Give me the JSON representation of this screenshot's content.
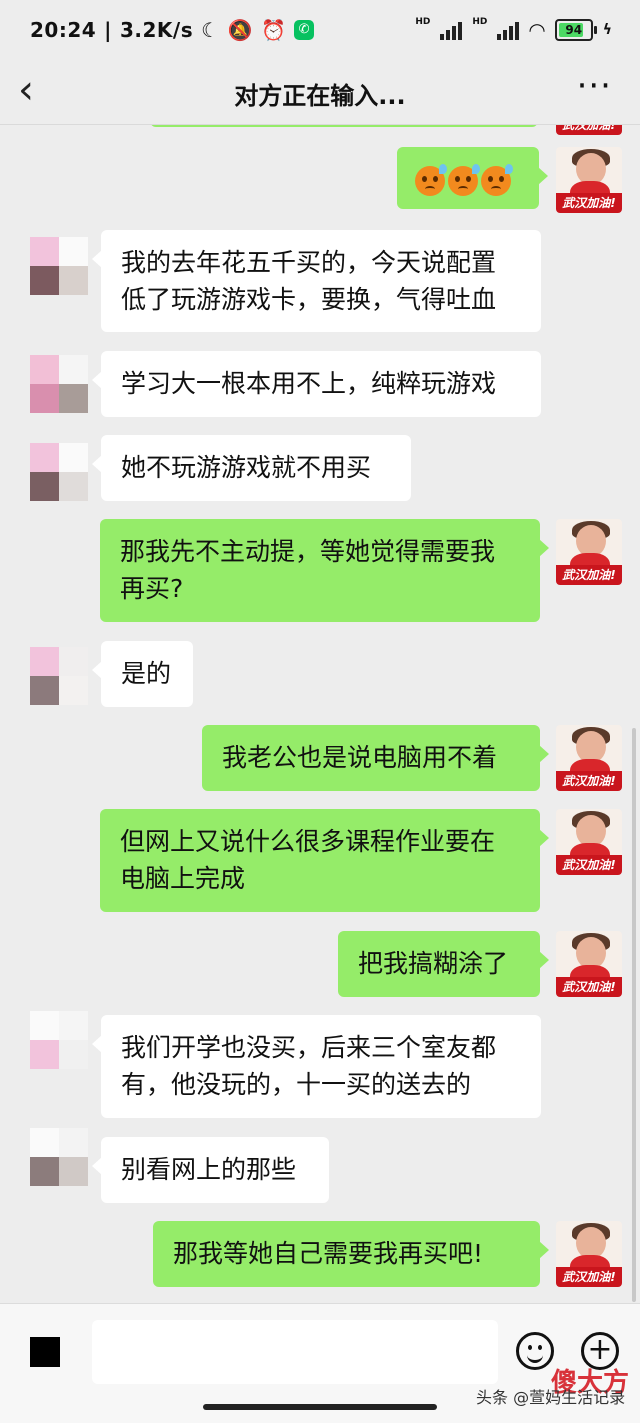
{
  "status_bar": {
    "time": "20:24",
    "speed": "3.2K/s",
    "battery": "94",
    "hd": "HD",
    "chat_app_glyph": "✆",
    "icons": [
      "moon-icon",
      "mute-icon",
      "alarm-icon",
      "wechat-icon",
      "signal-icon",
      "wifi-icon",
      "battery-icon",
      "charging-icon"
    ]
  },
  "header": {
    "title": "对方正在输入...",
    "back_glyph": "‹",
    "more_glyph": "···"
  },
  "avatar_banner": "武汉加油!",
  "messages": [
    {
      "side": "left",
      "lines": [
        "我的去年花五千买的，今天说配置",
        "低了玩游游戏卡，要换，气得吐血"
      ]
    },
    {
      "side": "left",
      "lines": [
        "学习大一根本用不上，纯粹玩游戏"
      ]
    },
    {
      "side": "left",
      "lines": [
        "她不玩游游戏就不用买"
      ]
    },
    {
      "side": "right",
      "lines": [
        "那我先不主动提，等她觉得需要我",
        "再买?"
      ]
    },
    {
      "side": "left",
      "lines": [
        "是的"
      ]
    },
    {
      "side": "right",
      "lines": [
        "我老公也是说电脑用不着"
      ]
    },
    {
      "side": "right",
      "lines": [
        "但网上又说什么很多课程作业要在",
        "电脑上完成"
      ]
    },
    {
      "side": "right",
      "lines": [
        "把我搞糊涂了"
      ]
    },
    {
      "side": "left",
      "lines": [
        "我们开学也没买，后来三个室友都",
        "有，他没玩的，十一买的送去的"
      ]
    },
    {
      "side": "left",
      "lines": [
        "别看网上的那些"
      ]
    },
    {
      "side": "right",
      "lines": [
        "那我等她自己需要我再买吧!"
      ]
    }
  ],
  "input_bar": {
    "plus_glyph": "+"
  },
  "watermark": {
    "text": "头条 @萱妈生活记录",
    "logo": "傻大方"
  },
  "colors": {
    "sent_bubble": "#95ec69",
    "received_bubble": "#ffffff",
    "background": "#ededed"
  }
}
